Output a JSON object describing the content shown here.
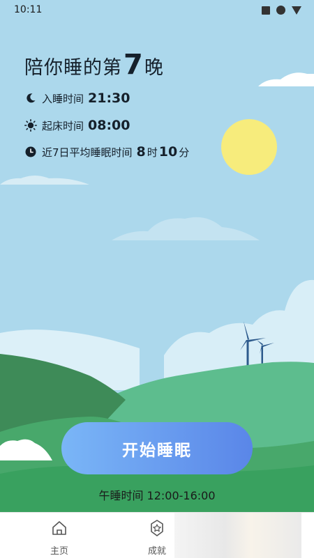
{
  "status_bar": {
    "time": "10:11"
  },
  "header": {
    "title_prefix": "陪你睡的第",
    "night_number": "7",
    "title_suffix": "晚"
  },
  "sleep_info": {
    "bedtime_label": "入睡时间",
    "bedtime_value": "21:30",
    "wake_label": "起床时间",
    "wake_value": "08:00",
    "average_label": "近7日平均睡眠时间",
    "average_hours": "8",
    "hours_unit": "时",
    "average_minutes": "10",
    "minutes_unit": "分"
  },
  "actions": {
    "start_button_label": "开始睡眠",
    "nap_time_text": "午睡时间 12:00-16:00"
  },
  "bottom_nav": {
    "items": [
      {
        "label": "主页",
        "icon": "home-icon"
      },
      {
        "label": "成就",
        "icon": "star-icon"
      }
    ]
  },
  "colors": {
    "sky": "#acd8ec",
    "sun": "#f7ec7c",
    "hill_dark": "#3e8b58",
    "hill_light": "#5cbc86",
    "button_start": "#7ab6f7",
    "button_end": "#5a86e8"
  }
}
